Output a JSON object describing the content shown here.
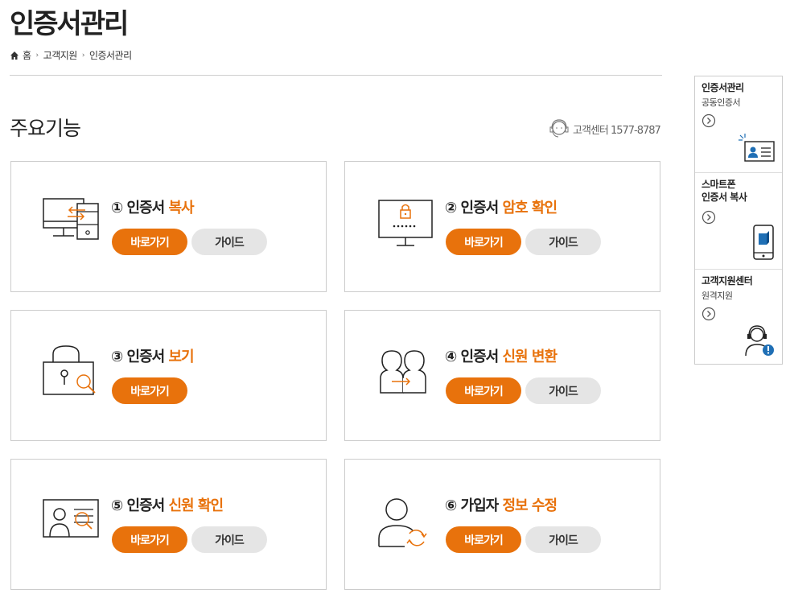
{
  "page": {
    "title": "인증서관리",
    "breadcrumb": [
      "홈",
      "고객지원",
      "인증서관리"
    ]
  },
  "section": {
    "title": "주요기능",
    "support_text": "고객센터 1577-8787"
  },
  "cards": [
    {
      "num": "①",
      "prefix": "인증서",
      "accent": "복사",
      "go": "바로가기",
      "guide": "가이드"
    },
    {
      "num": "②",
      "prefix": "인증서",
      "accent": "암호 확인",
      "go": "바로가기",
      "guide": "가이드"
    },
    {
      "num": "③",
      "prefix": "인증서",
      "accent": "보기",
      "go": "바로가기"
    },
    {
      "num": "④",
      "prefix": "인증서",
      "accent": "신원 변환",
      "go": "바로가기",
      "guide": "가이드"
    },
    {
      "num": "⑤",
      "prefix": "인증서",
      "accent": "신원 확인",
      "go": "바로가기",
      "guide": "가이드"
    },
    {
      "num": "⑥",
      "prefix": "가입자",
      "accent": "정보 수정",
      "go": "바로가기",
      "guide": "가이드"
    }
  ],
  "sidebar": [
    {
      "title": "인증서관리",
      "sub": "공동인증서"
    },
    {
      "title": "스마트폰\n인증서 복사",
      "sub": ""
    },
    {
      "title": "고객지원센터",
      "sub": "원격지원"
    }
  ],
  "colors": {
    "accent": "#e8720c",
    "guide_bg": "#e5e5e5",
    "border": "#cccccc"
  },
  "icons": [
    "home-icon",
    "headset-agent-icon",
    "monitor-transfer-icon",
    "monitor-lock-icon",
    "padlock-search-icon",
    "users-transfer-icon",
    "id-card-search-icon",
    "user-refresh-icon",
    "id-card-icon",
    "smartphone-icon",
    "support-agent-icon",
    "chevron-right-circle-icon"
  ]
}
